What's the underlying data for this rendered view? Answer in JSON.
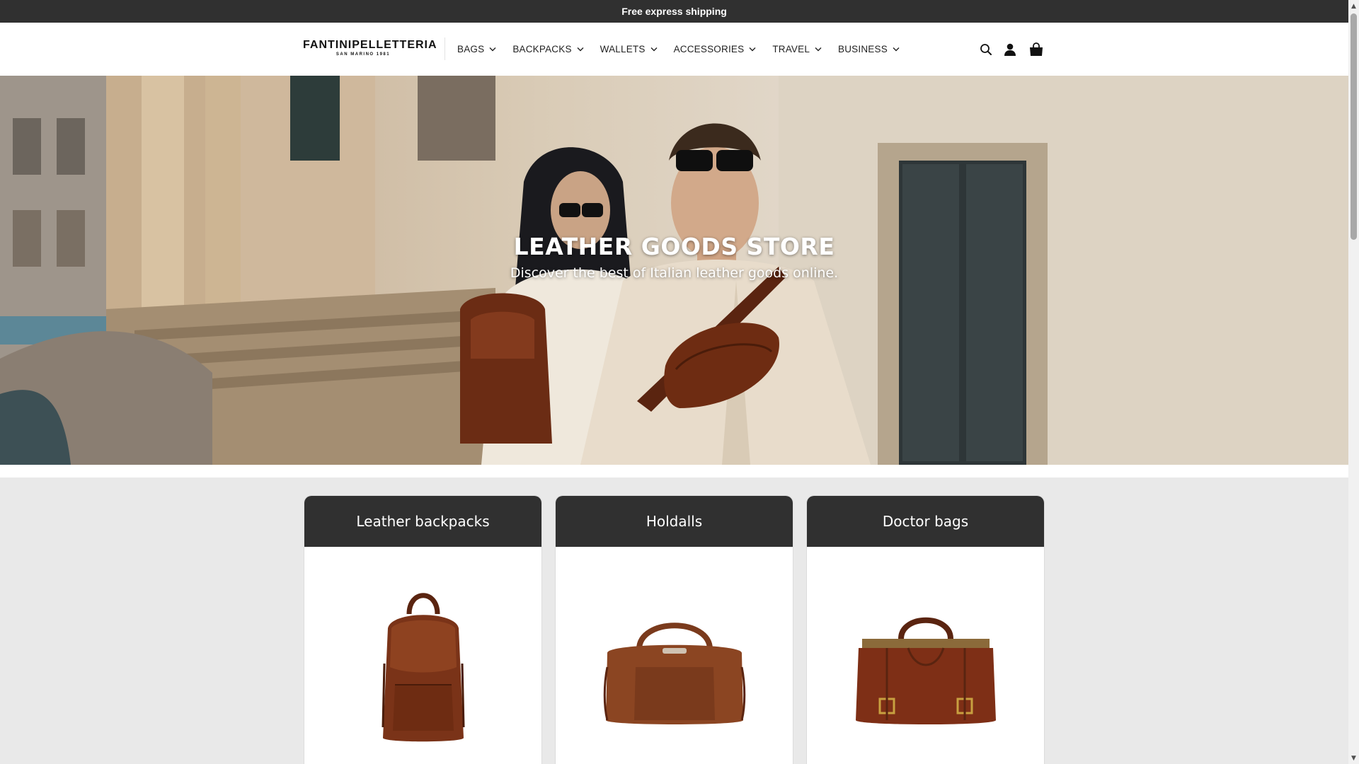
{
  "announcement": {
    "text": "Free express shipping"
  },
  "brand": {
    "name": "FANTINIPELLETTERIA",
    "tagline": "SAN MARINO 1981"
  },
  "nav": {
    "items": [
      {
        "label": "BAGS"
      },
      {
        "label": "BACKPACKS"
      },
      {
        "label": "WALLETS"
      },
      {
        "label": "ACCESSORIES"
      },
      {
        "label": "TRAVEL"
      },
      {
        "label": "BUSINESS"
      }
    ]
  },
  "header_icons": [
    "search-icon",
    "account-icon",
    "cart-icon"
  ],
  "hero": {
    "title": "LEATHER GOODS STORE",
    "subtitle": "Discover the best of Italian leather goods online."
  },
  "categories": [
    {
      "title": "Leather backpacks",
      "icon": "backpack-product-image"
    },
    {
      "title": "Holdalls",
      "icon": "holdall-product-image"
    },
    {
      "title": "Doctor bags",
      "icon": "doctor-bag-product-image"
    }
  ],
  "colors": {
    "topbar": "#303030",
    "card_header": "#303030",
    "leather": "#7a3a1c"
  }
}
